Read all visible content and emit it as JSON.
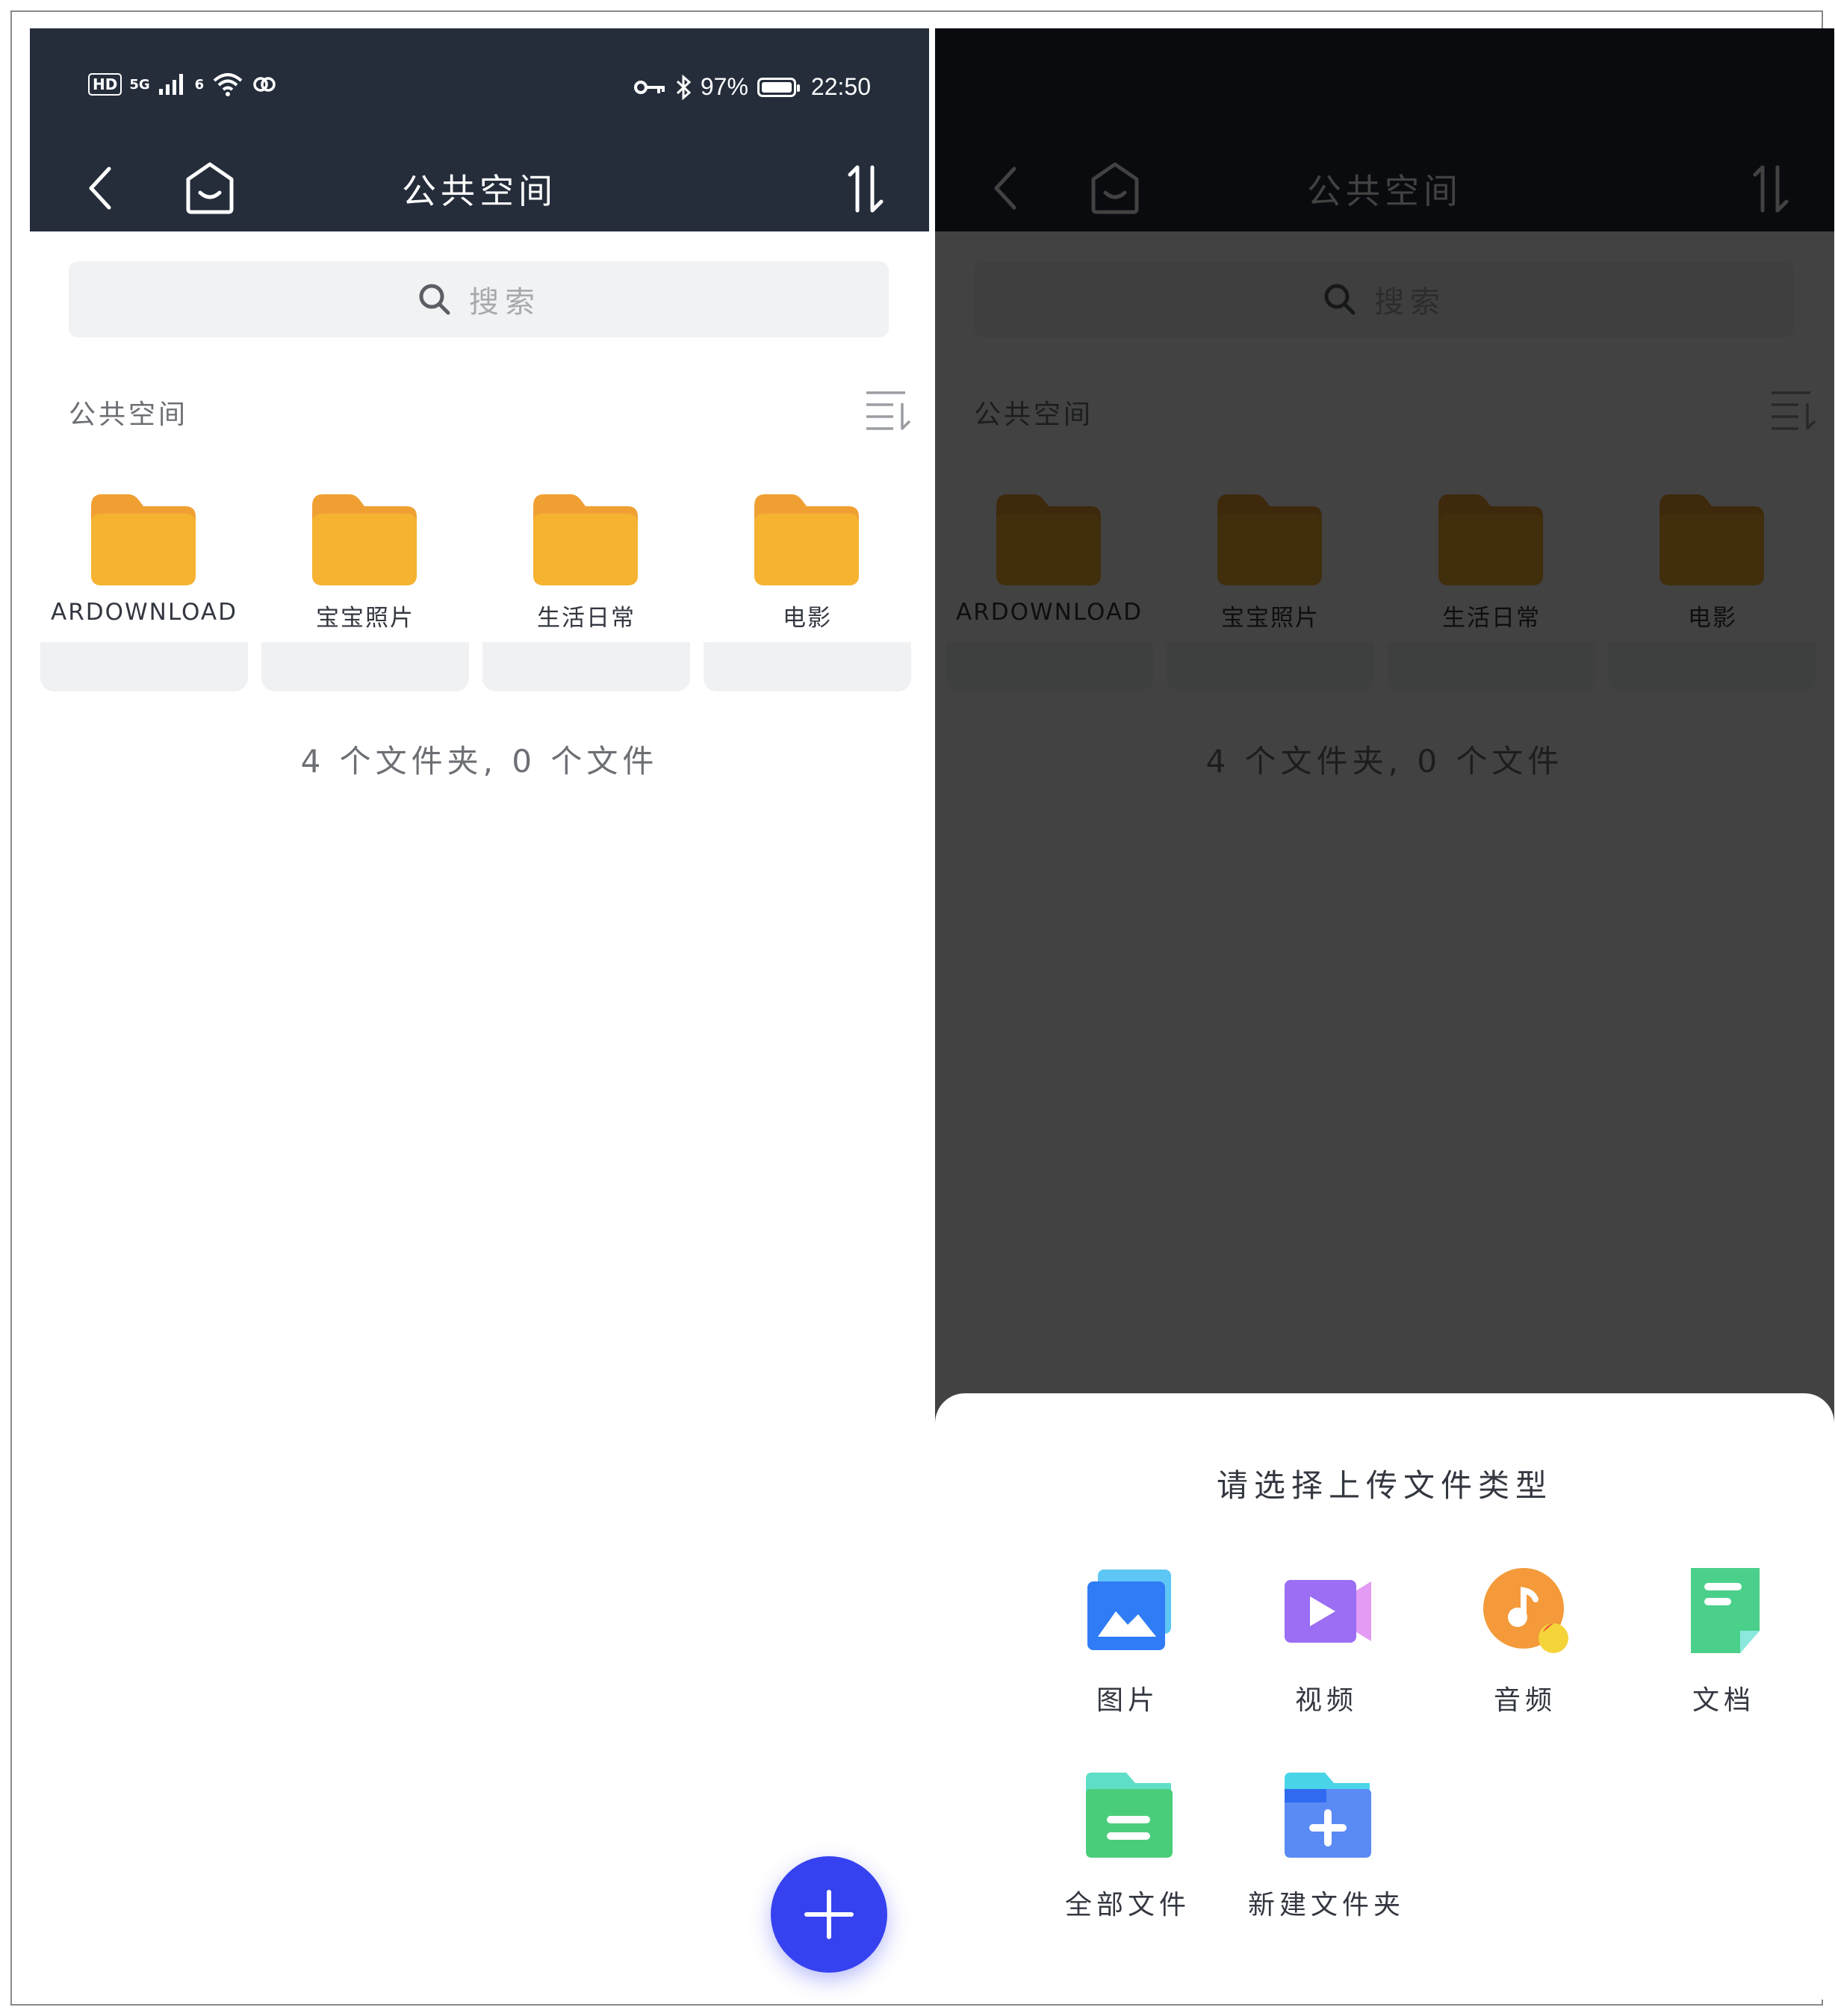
{
  "status_bar": {
    "left": {
      "hd": "HD",
      "network": "5G",
      "sub": "6"
    },
    "right": {
      "battery": "97%",
      "time": "22:50"
    }
  },
  "header": {
    "title": "公共空间"
  },
  "search": {
    "placeholder": "搜索"
  },
  "section": {
    "title": "公共空间"
  },
  "folders": [
    {
      "name": "ARDOWNLOAD"
    },
    {
      "name": "宝宝照片"
    },
    {
      "name": "生活日常"
    },
    {
      "name": "电影"
    }
  ],
  "summary": "4 个文件夹, 0 个文件",
  "upload_sheet": {
    "title": "请选择上传文件类型",
    "types": [
      {
        "label": "图片",
        "icon": "image-icon"
      },
      {
        "label": "视频",
        "icon": "video-icon"
      },
      {
        "label": "音频",
        "icon": "audio-icon"
      },
      {
        "label": "文档",
        "icon": "document-icon"
      },
      {
        "label": "全部文件",
        "icon": "all-files-icon"
      },
      {
        "label": "新建文件夹",
        "icon": "new-folder-icon"
      }
    ]
  },
  "colors": {
    "appbar": "#252d3b",
    "fab": "#3642f0",
    "folder": "#f5b331"
  }
}
